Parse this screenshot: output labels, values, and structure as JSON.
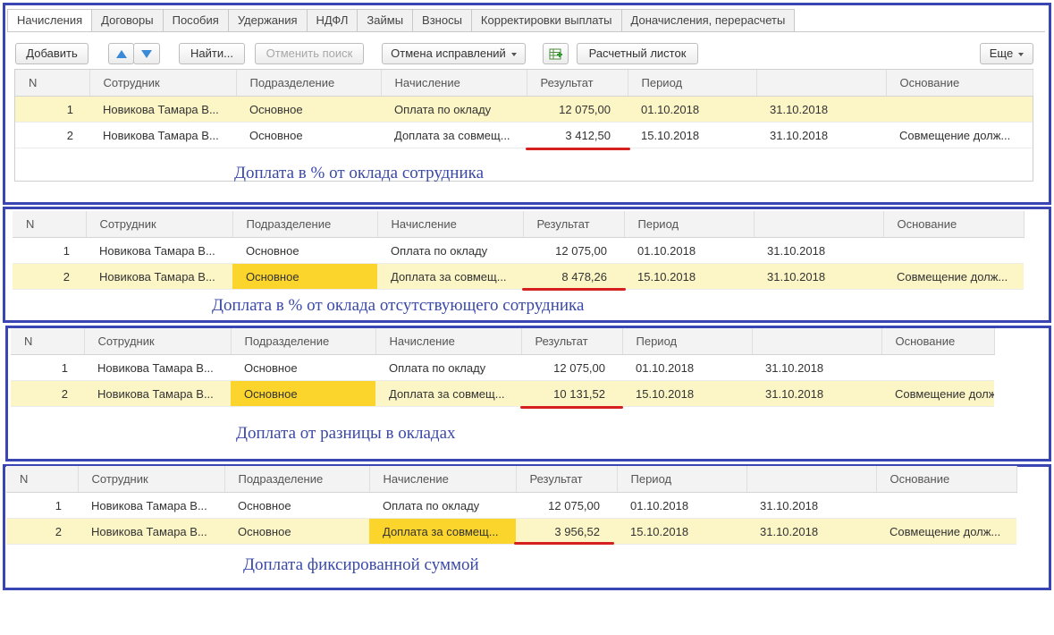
{
  "tabs": [
    "Начисления",
    "Договоры",
    "Пособия",
    "Удержания",
    "НДФЛ",
    "Займы",
    "Взносы",
    "Корректировки выплаты",
    "Доначисления, перерасчеты"
  ],
  "toolbar": {
    "add": "Добавить",
    "find": "Найти...",
    "cancel_search": "Отменить поиск",
    "cancel_corrections": "Отмена исправлений",
    "payslip": "Расчетный листок",
    "more": "Еще"
  },
  "columns": [
    "N",
    "Сотрудник",
    "Подразделение",
    "Начисление",
    "Результат",
    "Период",
    "",
    "Основание"
  ],
  "accent_colors": {
    "frame": "#3a45b4",
    "highlight_row": "#fcf5c5",
    "highlight_cell": "#fbd52b",
    "underline": "#d61f1f",
    "caption": "#3a49a8"
  },
  "panels": [
    {
      "caption": "Доплата в % от оклада сотрудника",
      "rows": [
        {
          "n": "1",
          "employee": "Новикова Тамара В...",
          "dept": "Основное",
          "accrual": "Оплата по окладу",
          "result": "12 075,00",
          "from": "01.10.2018",
          "to": "31.10.2018",
          "basis": ""
        },
        {
          "n": "2",
          "employee": "Новикова Тамара В...",
          "dept": "Основное",
          "accrual": "Доплата за совмещ...",
          "result": "3 412,50",
          "from": "15.10.2018",
          "to": "31.10.2018",
          "basis": "Совмещение долж..."
        }
      ]
    },
    {
      "caption": "Доплата в % от оклада отсутствующего сотрудника",
      "rows": [
        {
          "n": "1",
          "employee": "Новикова Тамара В...",
          "dept": "Основное",
          "accrual": "Оплата по окладу",
          "result": "12 075,00",
          "from": "01.10.2018",
          "to": "31.10.2018",
          "basis": ""
        },
        {
          "n": "2",
          "employee": "Новикова Тамара В...",
          "dept": "Основное",
          "accrual": "Доплата за совмещ...",
          "result": "8 478,26",
          "from": "15.10.2018",
          "to": "31.10.2018",
          "basis": "Совмещение долж..."
        }
      ]
    },
    {
      "caption": "Доплата от разницы в окладах",
      "rows": [
        {
          "n": "1",
          "employee": "Новикова Тамара В...",
          "dept": "Основное",
          "accrual": "Оплата по окладу",
          "result": "12 075,00",
          "from": "01.10.2018",
          "to": "31.10.2018",
          "basis": ""
        },
        {
          "n": "2",
          "employee": "Новикова Тамара В...",
          "dept": "Основное",
          "accrual": "Доплата за совмещ...",
          "result": "10 131,52",
          "from": "15.10.2018",
          "to": "31.10.2018",
          "basis": "Совмещение долж"
        }
      ]
    },
    {
      "caption": "Доплата фиксированной суммой",
      "rows": [
        {
          "n": "1",
          "employee": "Новикова Тамара В...",
          "dept": "Основное",
          "accrual": "Оплата по окладу",
          "result": "12 075,00",
          "from": "01.10.2018",
          "to": "31.10.2018",
          "basis": ""
        },
        {
          "n": "2",
          "employee": "Новикова Тамара В...",
          "dept": "Основное",
          "accrual": "Доплата за совмещ...",
          "result": "3 956,52",
          "from": "15.10.2018",
          "to": "31.10.2018",
          "basis": "Совмещение долж..."
        }
      ]
    }
  ]
}
